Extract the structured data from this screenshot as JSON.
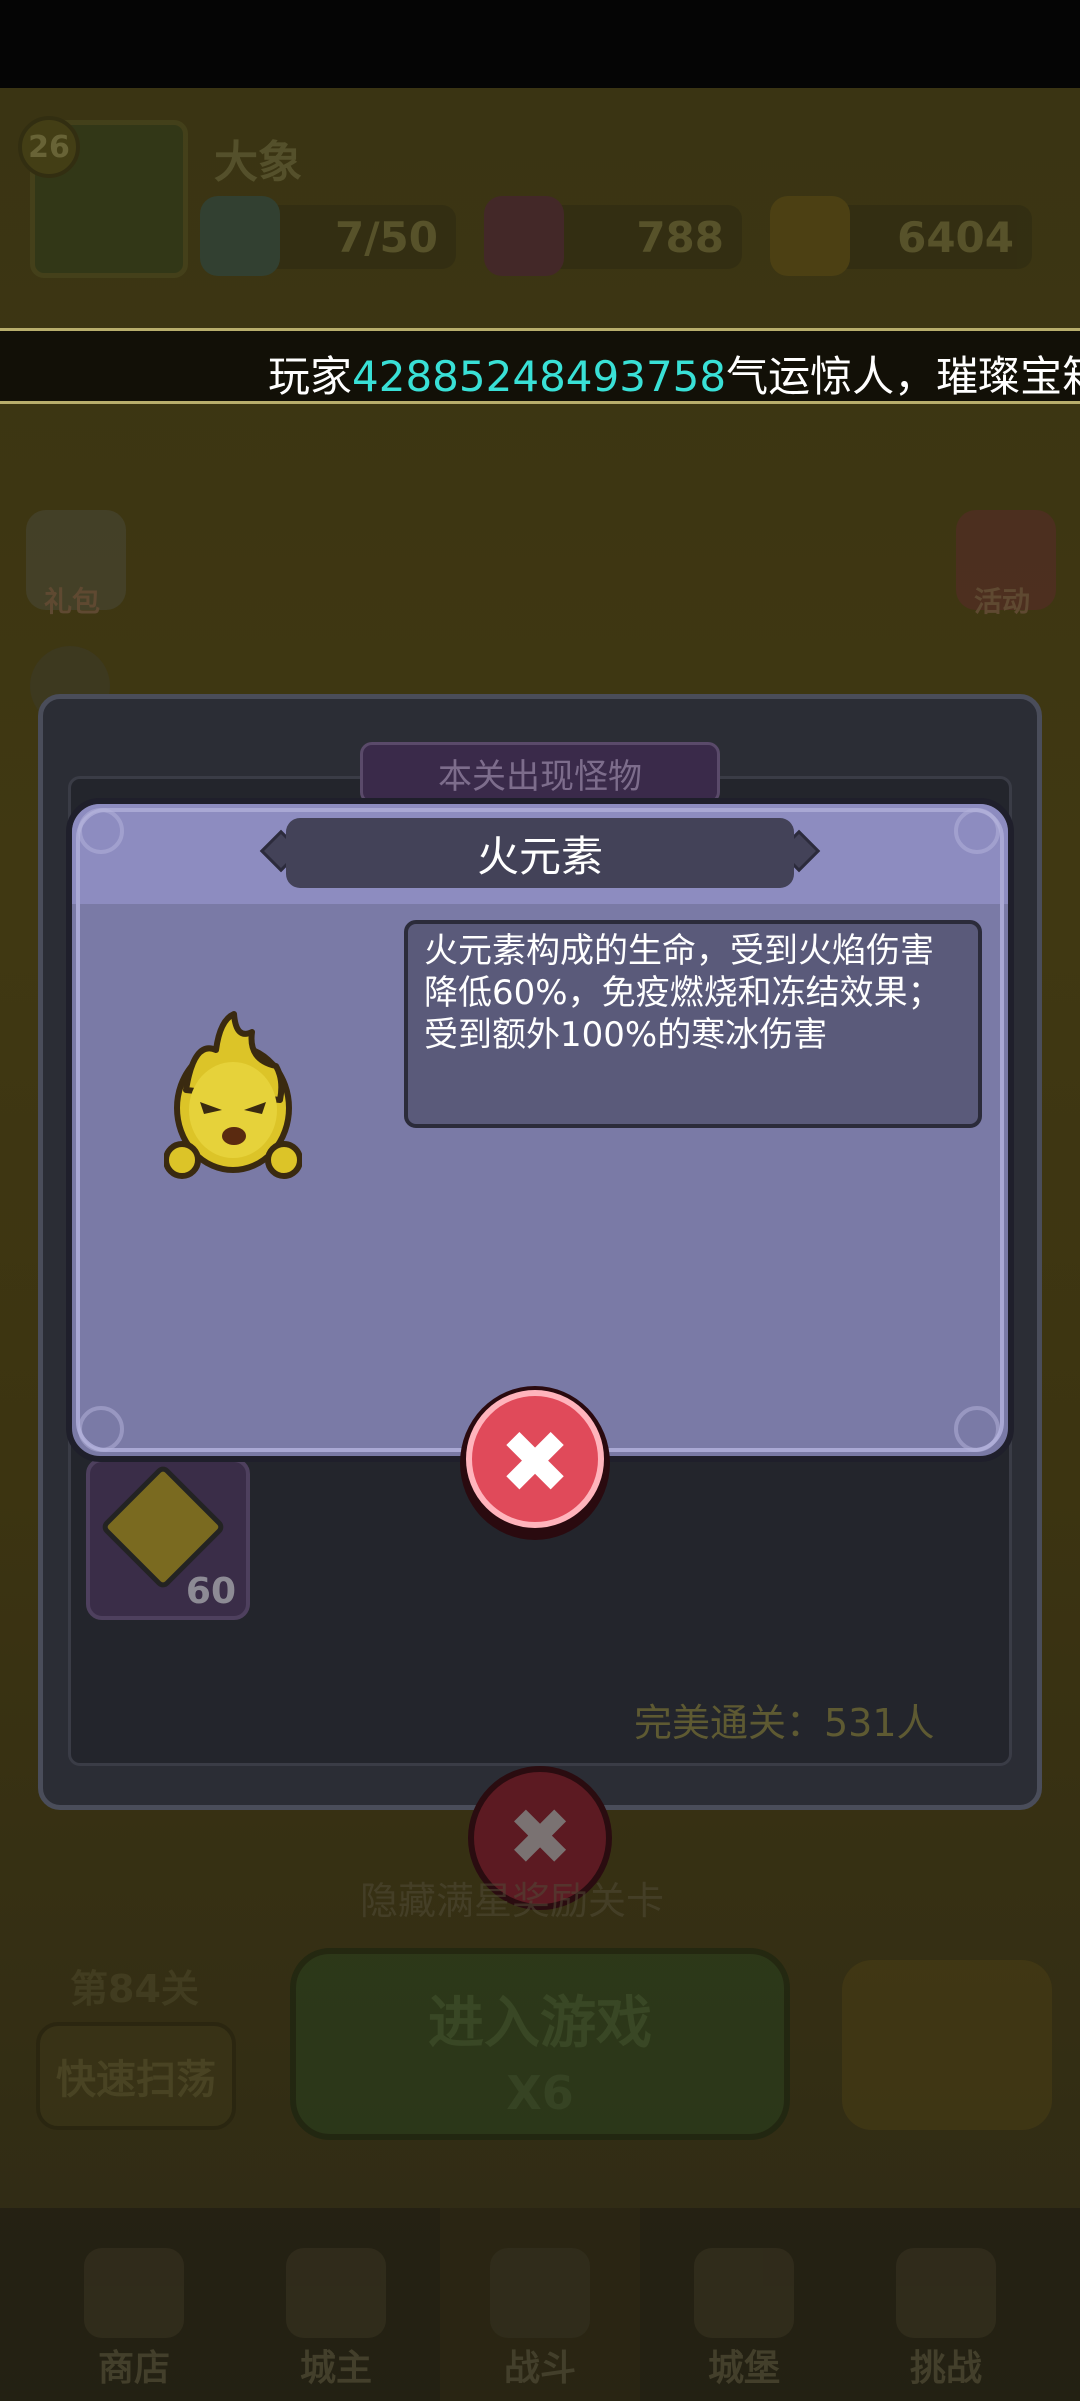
{
  "player": {
    "level": "26",
    "name": "大象",
    "energy": "7/50",
    "gems": "788",
    "gold": "6404"
  },
  "ticker": {
    "prefix": "玩家",
    "player_id": "42885248493758",
    "suffix": "气运惊人，璀璨宝箱"
  },
  "side": {
    "gift_label": "礼包",
    "activity_label": "活动"
  },
  "monster_panel": {
    "title": "本关出现怪物",
    "item_count": "60",
    "perfect_clear": "完美通关：531人"
  },
  "lobby": {
    "hidden_stage_text": "隐藏满星奖励关卡",
    "stage_label": "第84关",
    "sweep_label": "快速扫荡",
    "enter_label": "进入游戏",
    "enter_cost": "X6"
  },
  "nav": {
    "shop": "商店",
    "lord": "城主",
    "battle": "战斗",
    "castle": "城堡",
    "challenge": "挑战"
  },
  "modal": {
    "title": "火元素",
    "description": "火元素构成的生命，受到火焰伤害降低60%，免疫燃烧和冻结效果；受到额外100%的寒冰伤害",
    "close_symbol": "✖"
  },
  "colors": {
    "ticker_number": "#39e0d6",
    "close_red": "#e04a5a",
    "modal_bg": "#7a7aa6"
  }
}
